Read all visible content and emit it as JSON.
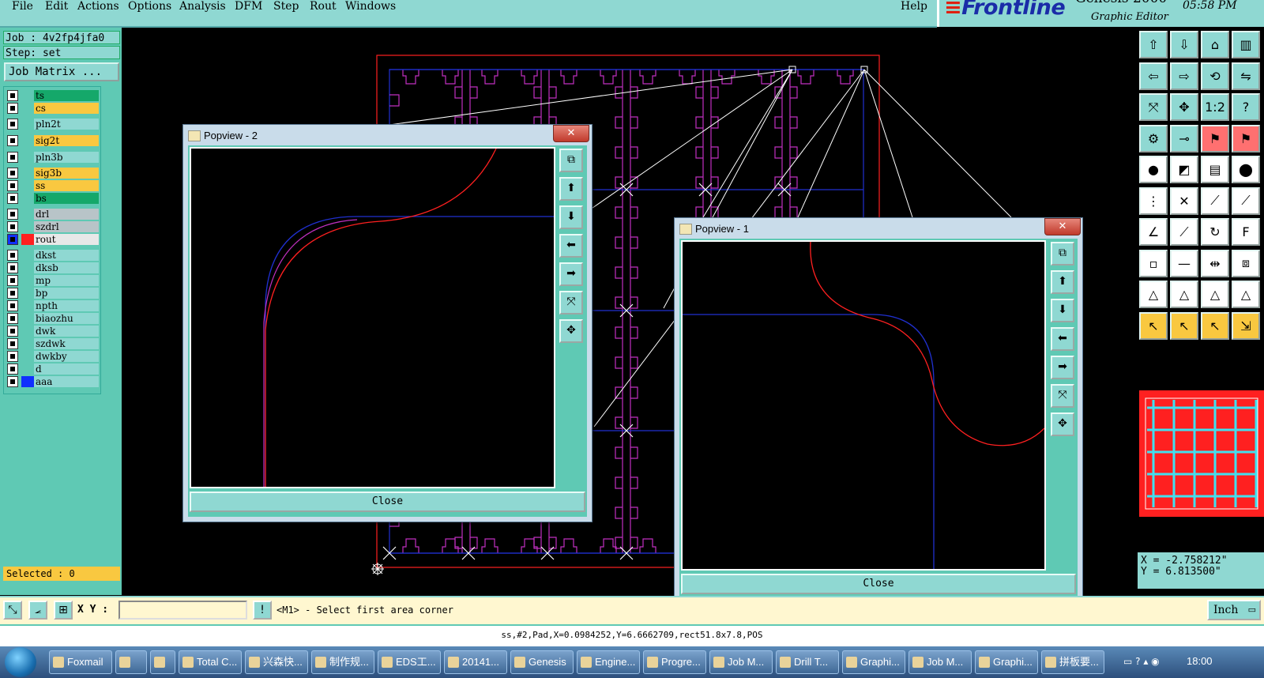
{
  "menu": {
    "items": [
      "File",
      "Edit",
      "Actions",
      "Options",
      "Analysis",
      "DFM",
      "Step",
      "Rout",
      "Windows"
    ],
    "help": "Help"
  },
  "brand": {
    "logo": "Frontline",
    "product": "Genesis 2000",
    "subtitle": "Graphic Editor",
    "time": "05:58 PM"
  },
  "left": {
    "job": "Job : 4v2fp4jfa0",
    "step": "Step: set",
    "job_matrix": "Job Matrix ...",
    "selected": "Selected : 0"
  },
  "layers": [
    {
      "name": "ts",
      "color": "#15a86a"
    },
    {
      "name": "cs",
      "color": "#f9c840"
    },
    {
      "name": "pln2t",
      "color": "#8fd8d2"
    },
    {
      "name": "sig2t",
      "color": "#f9c840"
    },
    {
      "name": "pln3b",
      "color": "#8fd8d2"
    },
    {
      "name": "sig3b",
      "color": "#f9c840"
    },
    {
      "name": "ss",
      "color": "#f9c840"
    },
    {
      "name": "bs",
      "color": "#15a86a"
    },
    {
      "name": "drl",
      "color": "#b8c4c8"
    },
    {
      "name": "szdrl",
      "color": "#b8c4c8"
    },
    {
      "name": "rout",
      "color": "#e8e8e8",
      "active": true
    },
    {
      "name": "dkst",
      "color": "#8fd8d2"
    },
    {
      "name": "dksb",
      "color": "#8fd8d2"
    },
    {
      "name": "mp",
      "color": "#8fd8d2"
    },
    {
      "name": "bp",
      "color": "#8fd8d2"
    },
    {
      "name": "npth",
      "color": "#8fd8d2"
    },
    {
      "name": "biaozhu",
      "color": "#8fd8d2"
    },
    {
      "name": "dwk",
      "color": "#8fd8d2"
    },
    {
      "name": "szdwk",
      "color": "#8fd8d2"
    },
    {
      "name": "dwkby",
      "color": "#8fd8d2"
    },
    {
      "name": "d",
      "color": "#8fd8d2"
    },
    {
      "name": "aaa",
      "color": "#8fd8d2"
    }
  ],
  "coords": {
    "x": "X = -2.758212\"",
    "y": "Y =  6.813500\""
  },
  "cmd": {
    "xy_label": "X Y :",
    "xy_value": "",
    "prompt": "<M1> - Select first area corner",
    "unit": "Inch"
  },
  "status": "ss,#2,Pad,X=0.0984252,Y=6.6662709,rect51.8x7.8,POS",
  "popview2": {
    "title": "Popview - 2",
    "close": "Close"
  },
  "popview1": {
    "title": "Popview - 1",
    "close": "Close"
  },
  "taskbar": {
    "tasks": [
      "Foxmail",
      "",
      "",
      "Total C...",
      "兴森快...",
      "制作规...",
      "EDS工...",
      "20141...",
      "Genesis",
      "Engine...",
      "Progre...",
      "Job M...",
      "Drill T...",
      "Graphi...",
      "Job M...",
      "Graphi...",
      "拼板要..."
    ],
    "clock": "18:00"
  },
  "colors": {
    "panel": "#5fc9b4",
    "button": "#8fd8d2",
    "highlight": "#f9c840",
    "rout": "#ff2020",
    "profile": "#2030d0",
    "board": "#c030c0"
  }
}
